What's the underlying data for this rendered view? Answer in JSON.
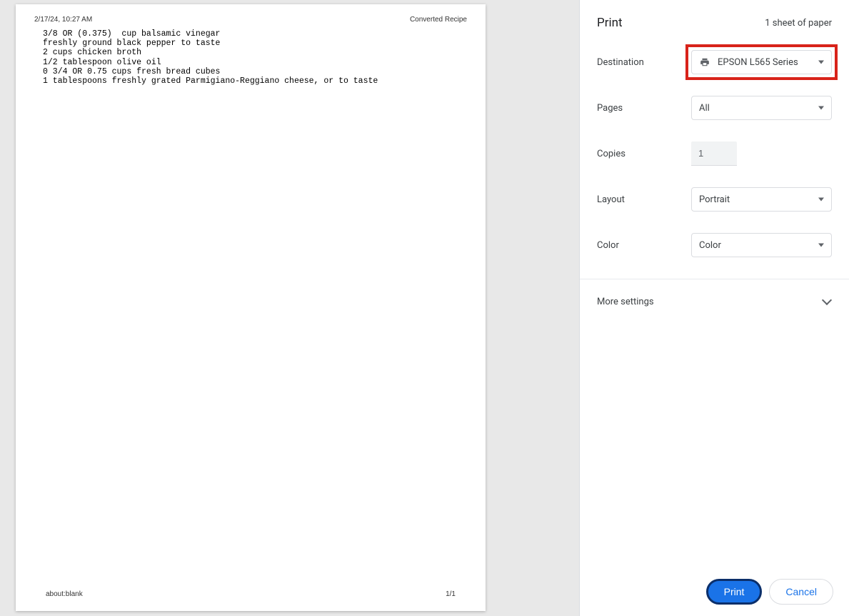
{
  "preview": {
    "header": {
      "timestamp": "2/17/24, 10:27 AM",
      "title": "Converted Recipe"
    },
    "lines": [
      "3/8 OR (0.375)  cup balsamic vinegar",
      "freshly ground black pepper to taste",
      "2 cups chicken broth",
      "1/2 tablespoon olive oil",
      "0 3/4 OR 0.75 cups fresh bread cubes",
      "1 tablespoons freshly grated Parmigiano-Reggiano cheese, or to taste"
    ],
    "footer": {
      "url": "about:blank",
      "page": "1/1"
    }
  },
  "panel": {
    "title": "Print",
    "sheet_count": "1 sheet of paper",
    "settings": {
      "destination": {
        "label": "Destination",
        "value": "EPSON L565 Series"
      },
      "pages": {
        "label": "Pages",
        "value": "All"
      },
      "copies": {
        "label": "Copies",
        "value": "1"
      },
      "layout": {
        "label": "Layout",
        "value": "Portrait"
      },
      "color": {
        "label": "Color",
        "value": "Color"
      }
    },
    "more_settings": "More settings",
    "buttons": {
      "print": "Print",
      "cancel": "Cancel"
    }
  },
  "highlight_color": "#d8231a"
}
